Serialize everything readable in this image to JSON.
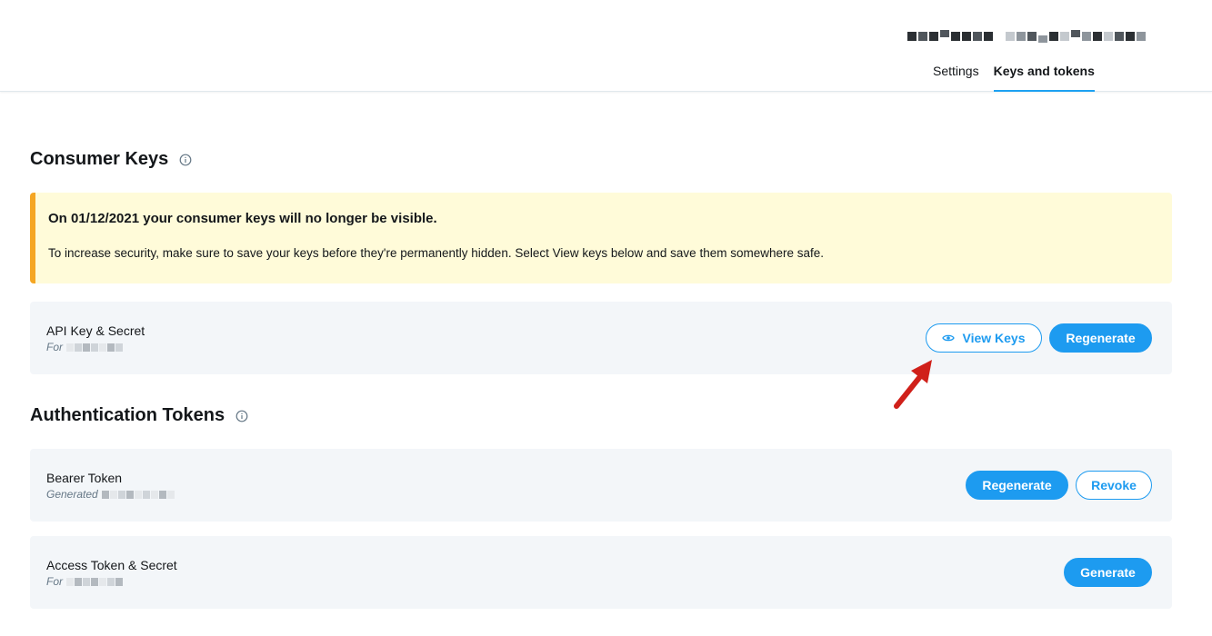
{
  "header": {
    "tabs": [
      {
        "label": "Settings"
      },
      {
        "label": "Keys and tokens"
      }
    ]
  },
  "consumer_keys": {
    "title": "Consumer Keys",
    "warning": {
      "title": "On 01/12/2021 your consumer keys will no longer be visible.",
      "text": "To increase security, make sure to save your keys before they're permanently hidden. Select View keys below and save them somewhere safe."
    },
    "api_key": {
      "title": "API Key & Secret",
      "sub_prefix": "For",
      "view_button": "View Keys",
      "regenerate_button": "Regenerate"
    }
  },
  "auth_tokens": {
    "title": "Authentication Tokens",
    "bearer": {
      "title": "Bearer Token",
      "sub_prefix": "Generated",
      "regenerate_button": "Regenerate",
      "revoke_button": "Revoke"
    },
    "access": {
      "title": "Access Token & Secret",
      "sub_prefix": "For",
      "generate_button": "Generate"
    }
  },
  "colors": {
    "accent": "#1d9bf0",
    "warning_bg": "#fffbd9",
    "warning_border": "#f5a623",
    "card_bg": "#f3f6f9",
    "arrow": "#d0201a"
  },
  "icons": [
    "info-icon",
    "eye-icon",
    "arrow-annotation"
  ]
}
